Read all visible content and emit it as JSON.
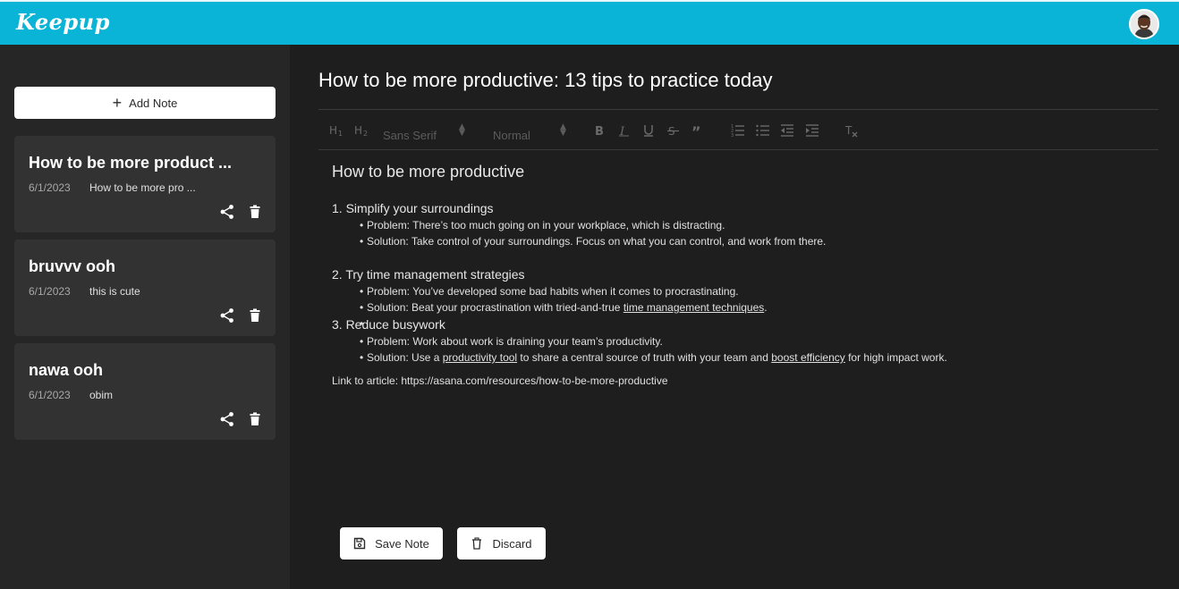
{
  "app": {
    "logo": "Keepup"
  },
  "sidebar": {
    "add_note_label": "Add Note",
    "notes": [
      {
        "title": "How to be more product ...",
        "date": "6/1/2023",
        "preview": "How to be more pro ..."
      },
      {
        "title": "bruvvv ooh",
        "date": "6/1/2023",
        "preview": "this is cute"
      },
      {
        "title": "nawa ooh",
        "date": "6/1/2023",
        "preview": "obim"
      }
    ]
  },
  "editor": {
    "title": "How to be more productive: 13 tips to practice today",
    "toolbar": {
      "font_select": "Sans Serif",
      "size_select": "Normal",
      "icons": [
        "h1-icon",
        "h2-icon",
        "bold-icon",
        "italic-icon",
        "underline-icon",
        "strike-icon",
        "quote-icon",
        "ordered-list-icon",
        "bullet-list-icon",
        "outdent-icon",
        "indent-icon",
        "clear-format-icon"
      ]
    },
    "content": {
      "heading": "How to be more productive",
      "sections": [
        {
          "title": "1. Simplify your surroundings",
          "problem": "Problem: There’s too much going on in your workplace, which is distracting.",
          "solution": "Solution: Take control of your surroundings. Focus on what you can control, and work from there."
        },
        {
          "title": "2. Try time management strategies",
          "problem": "Problem: You’ve developed some bad habits when it comes to procrastinating.",
          "solution_pre": "Solution: Beat your procrastination with tried-and-true ",
          "solution_link": "time management techniques",
          "solution_post": "."
        },
        {
          "title": "3. Reduce busywork",
          "problem": "Problem: Work about work is draining your team’s productivity.",
          "solution_pre": "Solution: Use a ",
          "solution_link1": "productivity tool",
          "solution_mid": " to share a central source of truth with your team and ",
          "solution_link2": "boost efficiency",
          "solution_post": " for high impact work."
        }
      ],
      "article_link": "Link to article: https://asana.com/resources/how-to-be-more-productive"
    },
    "save_label": "Save Note",
    "discard_label": "Discard"
  },
  "colors": {
    "header": "#0ab4d6",
    "sidebar": "#262626",
    "card": "#323232",
    "main": "#1e1e1e"
  }
}
